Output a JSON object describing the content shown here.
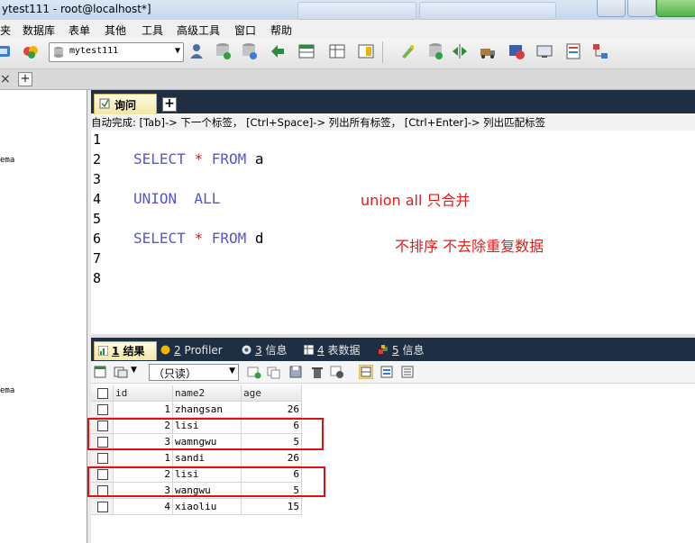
{
  "window": {
    "title": "ytest111 - root@localhost*]"
  },
  "menu": [
    "夹",
    "数据库",
    "表单",
    "其他",
    "工具",
    "高级工具",
    "窗口",
    "帮助"
  ],
  "toolbar": {
    "database": "mytest111"
  },
  "connection_tabs": {
    "close": "×",
    "add": "+"
  },
  "left_panel": {
    "schema_label_1": "ema",
    "schema_label_2": "ema"
  },
  "query_tab": {
    "label": "询问",
    "add": "+"
  },
  "autocomplete": "自动完成: [Tab]-> 下一个标签， [Ctrl+Space]-> 列出所有标签， [Ctrl+Enter]-> 列出匹配标签",
  "editor": {
    "line_numbers": [
      "1",
      "2",
      "3",
      "4",
      "5",
      "6",
      "7",
      "8"
    ],
    "lines": [
      {
        "kw1": "SELECT",
        "star": "*",
        "kw2": "FROM",
        "ident": "a"
      },
      {
        "kw": "UNION  ALL"
      },
      {
        "kw1": "SELECT",
        "star": "*",
        "kw2": "FROM",
        "ident": "d"
      }
    ],
    "annotations": [
      "union all 只合并",
      "不排序  不去除重复数据"
    ]
  },
  "result_tabs": [
    {
      "num": "1",
      "label": "结果"
    },
    {
      "num": "2",
      "label": "Profiler"
    },
    {
      "num": "3",
      "label": "信息"
    },
    {
      "num": "4",
      "label": "表数据"
    },
    {
      "num": "5",
      "label": "信息"
    }
  ],
  "result_toolbar": {
    "mode": "（只读）"
  },
  "grid": {
    "columns": [
      "id",
      "name2",
      "age"
    ],
    "rows": [
      [
        "1",
        "zhangsan",
        "26"
      ],
      [
        "2",
        "lisi",
        "6"
      ],
      [
        "3",
        "wamngwu",
        "5"
      ],
      [
        "1",
        "sandi",
        "26"
      ],
      [
        "2",
        "lisi",
        "6"
      ],
      [
        "3",
        "wangwu",
        "5"
      ],
      [
        "4",
        "xiaoliu",
        "15"
      ]
    ]
  },
  "colors": {
    "keyword": "#5454d6",
    "annotation": "#e21b1b",
    "highlight_box": "#e01010",
    "tab_header": "#1e2f44"
  }
}
